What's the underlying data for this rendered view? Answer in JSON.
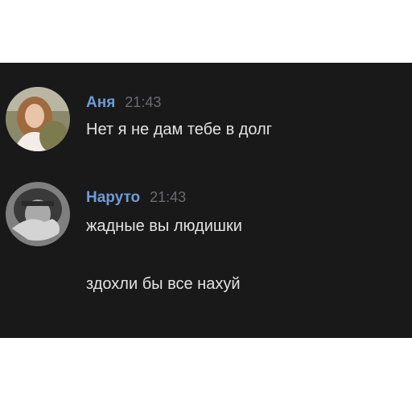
{
  "chat": {
    "messages": [
      {
        "author": "Аня",
        "time": "21:43",
        "avatar_icon": "user-photo-icon",
        "lines": [
          "Нет я не дам тебе в долг"
        ]
      },
      {
        "author": "Наруто",
        "time": "21:43",
        "avatar_icon": "user-photo-icon",
        "lines": [
          "жадные вы людишки",
          "здохли бы все нахуй"
        ]
      }
    ]
  },
  "colors": {
    "background": "#19191a",
    "author_name": "#6f9bd6",
    "timestamp": "#6b6b6e",
    "message_text": "#e3e3e3"
  }
}
